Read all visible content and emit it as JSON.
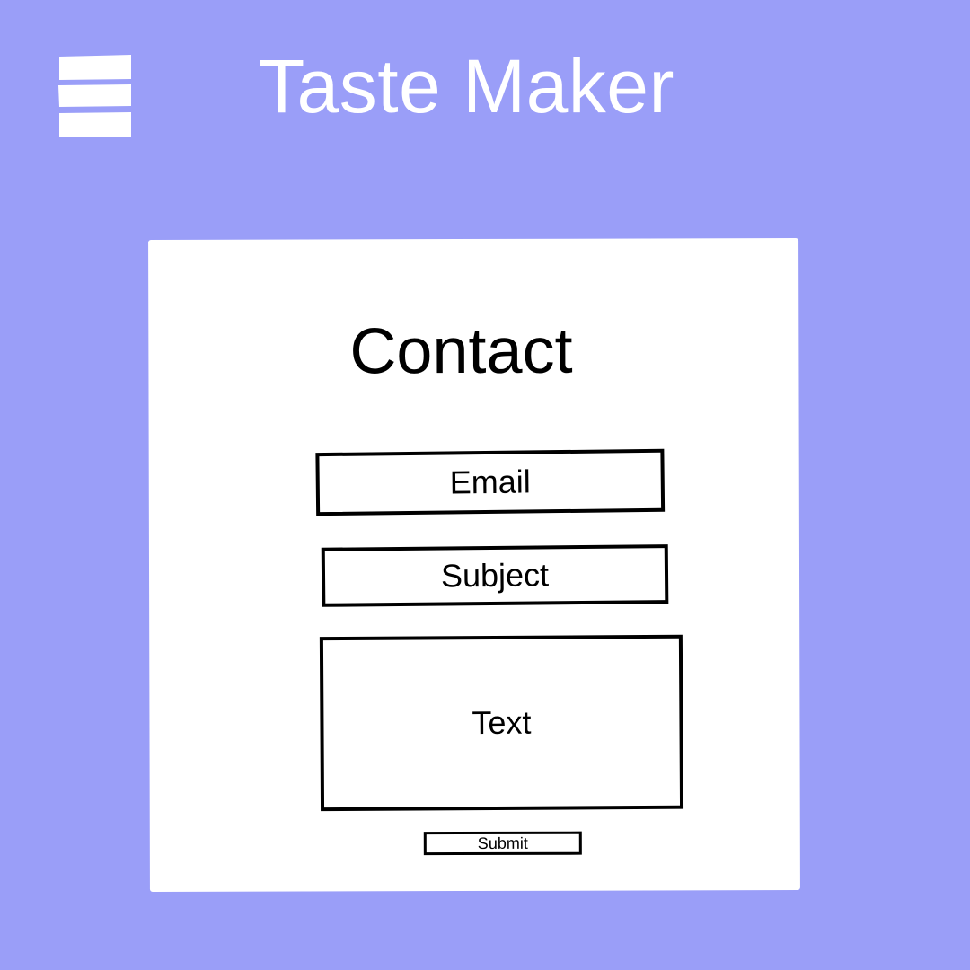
{
  "header": {
    "title": "Taste Maker",
    "menu_icon": "hamburger-menu-icon"
  },
  "contact": {
    "title": "Contact",
    "email_label": "Email",
    "subject_label": "Subject",
    "text_label": "Text",
    "submit_label": "Submit"
  },
  "colors": {
    "background": "#9a9ef8",
    "card": "#ffffff",
    "outline": "#000000",
    "header_text": "#ffffff"
  }
}
